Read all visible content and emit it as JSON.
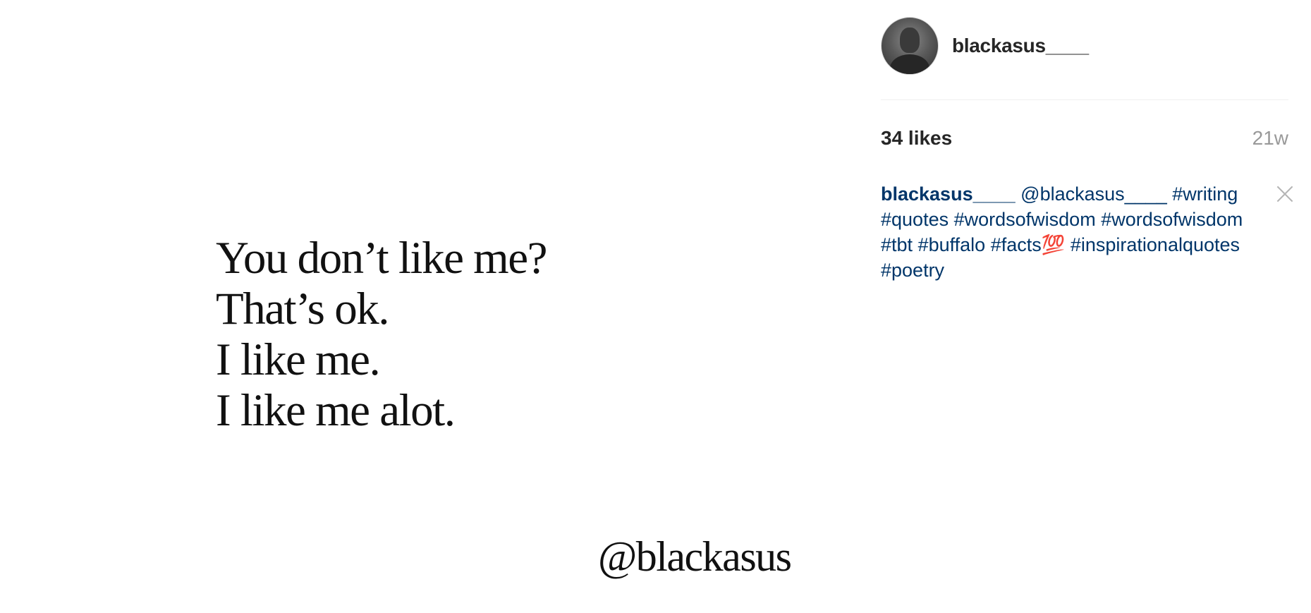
{
  "post": {
    "quote_lines": [
      "You don’t like me?",
      "That’s ok.",
      "I like me.",
      "I like me alot."
    ],
    "signature": "@blackasus"
  },
  "sidebar": {
    "username": "blackasus____",
    "avatar_icon": "user-avatar",
    "likes": "34 likes",
    "timestamp": "21w",
    "caption": {
      "author": "blackasus____",
      "tokens": [
        "@blackasus____",
        "#writing",
        "#quotes",
        "#wordsofwisdom",
        "#wordsofwisdom",
        "#tbt",
        "#buffalo",
        "#facts💯",
        "#inspirationalquotes",
        "#poetry"
      ]
    },
    "close_icon": "close-icon"
  },
  "colors": {
    "link": "#003569",
    "text": "#262626",
    "muted": "#999999",
    "divider": "#efefef"
  }
}
